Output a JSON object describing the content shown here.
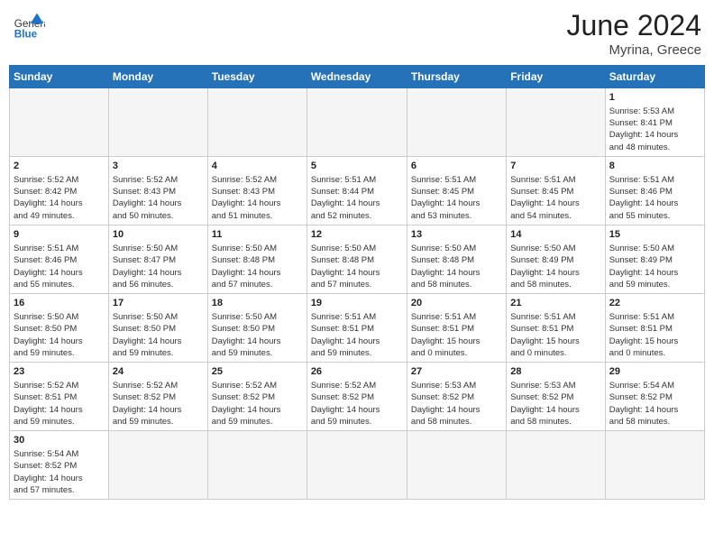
{
  "header": {
    "logo_general": "General",
    "logo_blue": "Blue",
    "month": "June 2024",
    "location": "Myrina, Greece"
  },
  "weekdays": [
    "Sunday",
    "Monday",
    "Tuesday",
    "Wednesday",
    "Thursday",
    "Friday",
    "Saturday"
  ],
  "weeks": [
    [
      {
        "day": "",
        "shade": true,
        "info": ""
      },
      {
        "day": "",
        "shade": true,
        "info": ""
      },
      {
        "day": "",
        "shade": true,
        "info": ""
      },
      {
        "day": "",
        "shade": true,
        "info": ""
      },
      {
        "day": "",
        "shade": true,
        "info": ""
      },
      {
        "day": "",
        "shade": true,
        "info": ""
      },
      {
        "day": "1",
        "shade": false,
        "info": "Sunrise: 5:53 AM\nSunset: 8:41 PM\nDaylight: 14 hours\nand 48 minutes."
      }
    ],
    [
      {
        "day": "2",
        "shade": false,
        "info": "Sunrise: 5:52 AM\nSunset: 8:42 PM\nDaylight: 14 hours\nand 49 minutes."
      },
      {
        "day": "3",
        "shade": false,
        "info": "Sunrise: 5:52 AM\nSunset: 8:43 PM\nDaylight: 14 hours\nand 50 minutes."
      },
      {
        "day": "4",
        "shade": false,
        "info": "Sunrise: 5:52 AM\nSunset: 8:43 PM\nDaylight: 14 hours\nand 51 minutes."
      },
      {
        "day": "5",
        "shade": false,
        "info": "Sunrise: 5:51 AM\nSunset: 8:44 PM\nDaylight: 14 hours\nand 52 minutes."
      },
      {
        "day": "6",
        "shade": false,
        "info": "Sunrise: 5:51 AM\nSunset: 8:45 PM\nDaylight: 14 hours\nand 53 minutes."
      },
      {
        "day": "7",
        "shade": false,
        "info": "Sunrise: 5:51 AM\nSunset: 8:45 PM\nDaylight: 14 hours\nand 54 minutes."
      },
      {
        "day": "8",
        "shade": false,
        "info": "Sunrise: 5:51 AM\nSunset: 8:46 PM\nDaylight: 14 hours\nand 55 minutes."
      }
    ],
    [
      {
        "day": "9",
        "shade": false,
        "info": "Sunrise: 5:51 AM\nSunset: 8:46 PM\nDaylight: 14 hours\nand 55 minutes."
      },
      {
        "day": "10",
        "shade": false,
        "info": "Sunrise: 5:50 AM\nSunset: 8:47 PM\nDaylight: 14 hours\nand 56 minutes."
      },
      {
        "day": "11",
        "shade": false,
        "info": "Sunrise: 5:50 AM\nSunset: 8:48 PM\nDaylight: 14 hours\nand 57 minutes."
      },
      {
        "day": "12",
        "shade": false,
        "info": "Sunrise: 5:50 AM\nSunset: 8:48 PM\nDaylight: 14 hours\nand 57 minutes."
      },
      {
        "day": "13",
        "shade": false,
        "info": "Sunrise: 5:50 AM\nSunset: 8:48 PM\nDaylight: 14 hours\nand 58 minutes."
      },
      {
        "day": "14",
        "shade": false,
        "info": "Sunrise: 5:50 AM\nSunset: 8:49 PM\nDaylight: 14 hours\nand 58 minutes."
      },
      {
        "day": "15",
        "shade": false,
        "info": "Sunrise: 5:50 AM\nSunset: 8:49 PM\nDaylight: 14 hours\nand 59 minutes."
      }
    ],
    [
      {
        "day": "16",
        "shade": false,
        "info": "Sunrise: 5:50 AM\nSunset: 8:50 PM\nDaylight: 14 hours\nand 59 minutes."
      },
      {
        "day": "17",
        "shade": false,
        "info": "Sunrise: 5:50 AM\nSunset: 8:50 PM\nDaylight: 14 hours\nand 59 minutes."
      },
      {
        "day": "18",
        "shade": false,
        "info": "Sunrise: 5:50 AM\nSunset: 8:50 PM\nDaylight: 14 hours\nand 59 minutes."
      },
      {
        "day": "19",
        "shade": false,
        "info": "Sunrise: 5:51 AM\nSunset: 8:51 PM\nDaylight: 14 hours\nand 59 minutes."
      },
      {
        "day": "20",
        "shade": false,
        "info": "Sunrise: 5:51 AM\nSunset: 8:51 PM\nDaylight: 15 hours\nand 0 minutes."
      },
      {
        "day": "21",
        "shade": false,
        "info": "Sunrise: 5:51 AM\nSunset: 8:51 PM\nDaylight: 15 hours\nand 0 minutes."
      },
      {
        "day": "22",
        "shade": false,
        "info": "Sunrise: 5:51 AM\nSunset: 8:51 PM\nDaylight: 15 hours\nand 0 minutes."
      }
    ],
    [
      {
        "day": "23",
        "shade": false,
        "info": "Sunrise: 5:52 AM\nSunset: 8:51 PM\nDaylight: 14 hours\nand 59 minutes."
      },
      {
        "day": "24",
        "shade": false,
        "info": "Sunrise: 5:52 AM\nSunset: 8:52 PM\nDaylight: 14 hours\nand 59 minutes."
      },
      {
        "day": "25",
        "shade": false,
        "info": "Sunrise: 5:52 AM\nSunset: 8:52 PM\nDaylight: 14 hours\nand 59 minutes."
      },
      {
        "day": "26",
        "shade": false,
        "info": "Sunrise: 5:52 AM\nSunset: 8:52 PM\nDaylight: 14 hours\nand 59 minutes."
      },
      {
        "day": "27",
        "shade": false,
        "info": "Sunrise: 5:53 AM\nSunset: 8:52 PM\nDaylight: 14 hours\nand 58 minutes."
      },
      {
        "day": "28",
        "shade": false,
        "info": "Sunrise: 5:53 AM\nSunset: 8:52 PM\nDaylight: 14 hours\nand 58 minutes."
      },
      {
        "day": "29",
        "shade": false,
        "info": "Sunrise: 5:54 AM\nSunset: 8:52 PM\nDaylight: 14 hours\nand 58 minutes."
      }
    ],
    [
      {
        "day": "30",
        "shade": false,
        "info": "Sunrise: 5:54 AM\nSunset: 8:52 PM\nDaylight: 14 hours\nand 57 minutes."
      },
      {
        "day": "",
        "shade": true,
        "info": ""
      },
      {
        "day": "",
        "shade": true,
        "info": ""
      },
      {
        "day": "",
        "shade": true,
        "info": ""
      },
      {
        "day": "",
        "shade": true,
        "info": ""
      },
      {
        "day": "",
        "shade": true,
        "info": ""
      },
      {
        "day": "",
        "shade": true,
        "info": ""
      }
    ]
  ]
}
